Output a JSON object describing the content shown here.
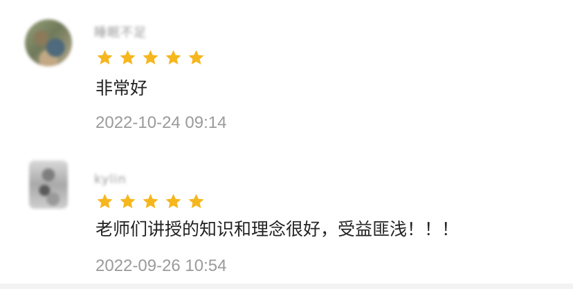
{
  "star_color": "#f6b61e",
  "reviews": [
    {
      "username": "睡眠不足",
      "rating": 5,
      "content": "非常好",
      "time": "2022-10-24 09:14",
      "avatar_icon": "user-avatar"
    },
    {
      "username": "kylin",
      "rating": 5,
      "content": "老师们讲授的知识和理念很好，受益匪浅！！！",
      "time": "2022-09-26 10:54",
      "avatar_icon": "user-avatar"
    }
  ]
}
